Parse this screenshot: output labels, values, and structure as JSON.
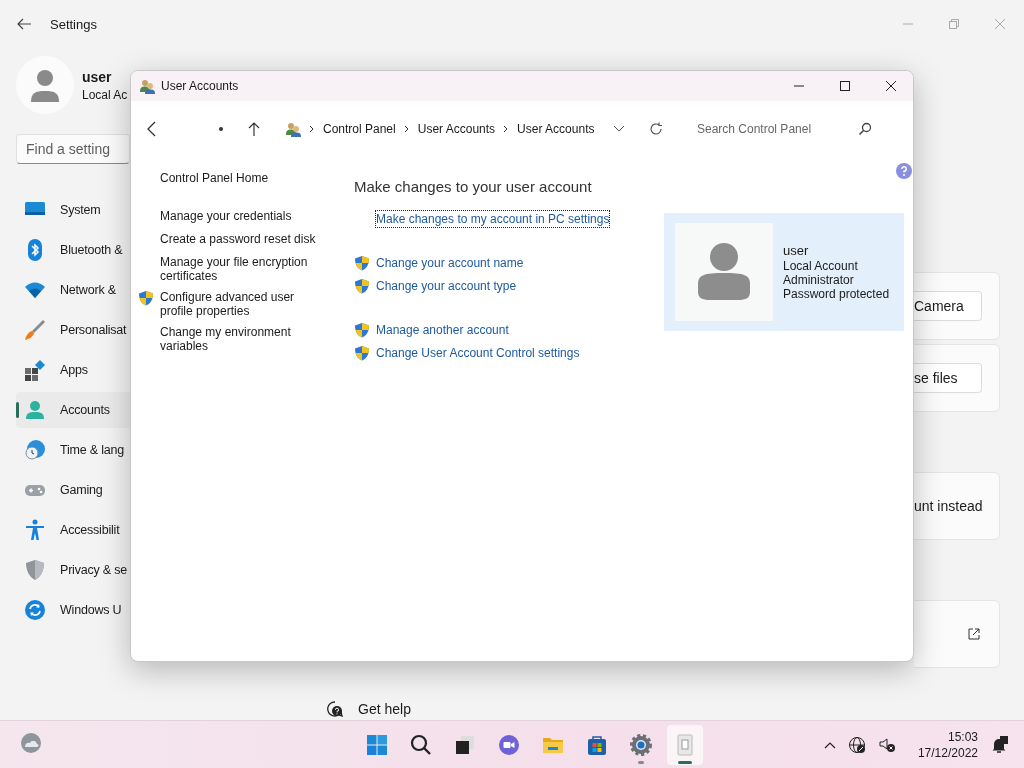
{
  "settings": {
    "title": "Settings",
    "user": {
      "name": "user",
      "account": "Local Ac"
    },
    "search": {
      "placeholder": "Find a setting"
    },
    "nav": [
      {
        "label": "System",
        "kind": "system",
        "selected": false
      },
      {
        "label": "Bluetooth &",
        "kind": "bluetooth",
        "selected": false
      },
      {
        "label": "Network &",
        "kind": "network",
        "selected": false
      },
      {
        "label": "Personalisat",
        "kind": "brush",
        "selected": false
      },
      {
        "label": "Apps",
        "kind": "apps",
        "selected": false
      },
      {
        "label": "Accounts",
        "kind": "accounts",
        "selected": true
      },
      {
        "label": "Time & lang",
        "kind": "time",
        "selected": false
      },
      {
        "label": "Gaming",
        "kind": "gaming",
        "selected": false
      },
      {
        "label": "Accessibilit",
        "kind": "accessibility",
        "selected": false
      },
      {
        "label": "Privacy & se",
        "kind": "privacy",
        "selected": false
      },
      {
        "label": "Windows U",
        "kind": "update",
        "selected": false
      }
    ],
    "cards": [
      {
        "kind": "button",
        "label": "Camera"
      },
      {
        "kind": "button",
        "label": "se files"
      },
      {
        "kind": "text",
        "label": "unt instead"
      },
      {
        "kind": "link"
      }
    ],
    "help": "Get help"
  },
  "control_panel": {
    "title": "User Accounts",
    "breadcrumb": [
      "Control Panel",
      "User Accounts",
      "User Accounts"
    ],
    "search": {
      "placeholder": "Search Control Panel"
    },
    "tasks": [
      {
        "label": "Control Panel Home",
        "shield": false
      },
      {
        "label": "Manage your credentials",
        "shield": false
      },
      {
        "label": "Create a password reset disk",
        "shield": false
      },
      {
        "label": "Manage your file encryption certificates",
        "shield": false
      },
      {
        "label": "Configure advanced user profile properties",
        "shield": true
      },
      {
        "label": "Change my environment variables",
        "shield": false
      }
    ],
    "heading": "Make changes to your user account",
    "link_groups": [
      [
        {
          "label": "Make changes to my account in PC settings",
          "shield": false,
          "focused": true
        }
      ],
      [
        {
          "label": "Change your account name",
          "shield": true,
          "focused": false
        },
        {
          "label": "Change your account type",
          "shield": true,
          "focused": false
        }
      ],
      [
        {
          "label": "Manage another account",
          "shield": true,
          "focused": false
        },
        {
          "label": "Change User Account Control settings",
          "shield": true,
          "focused": false
        }
      ]
    ],
    "account": {
      "name": "user",
      "lines": [
        "Local Account",
        "Administrator",
        "Password protected"
      ]
    }
  },
  "taskbar": {
    "apps": [
      {
        "kind": "start",
        "running": false,
        "active": false
      },
      {
        "kind": "search",
        "running": false,
        "active": false
      },
      {
        "kind": "taskview",
        "running": false,
        "active": false
      },
      {
        "kind": "chat",
        "running": false,
        "active": false
      },
      {
        "kind": "explorer",
        "running": false,
        "active": false
      },
      {
        "kind": "store",
        "running": false,
        "active": false
      },
      {
        "kind": "settings",
        "running": true,
        "active": false
      },
      {
        "kind": "panel",
        "running": true,
        "active": true
      }
    ],
    "time": "15:03",
    "date": "17/12/2022"
  }
}
